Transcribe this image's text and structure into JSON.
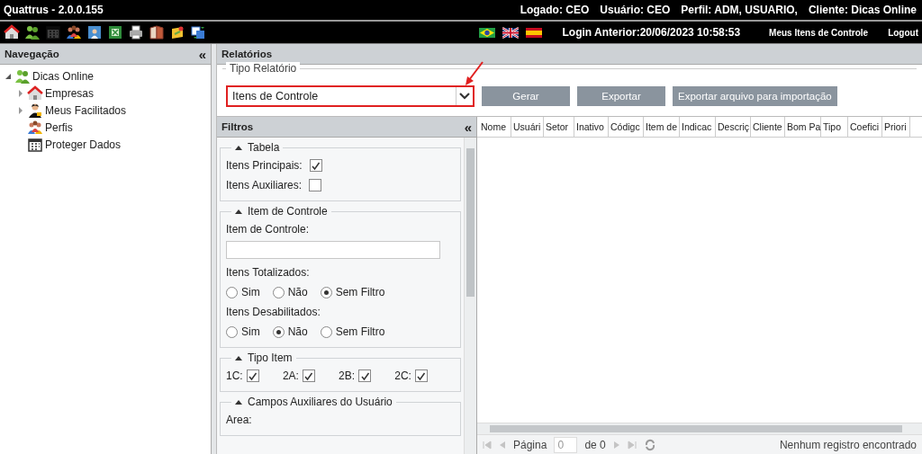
{
  "window": {
    "title": "Quattrus - 2.0.0.155"
  },
  "session": [
    {
      "label": "Logado:",
      "value": "CEO"
    },
    {
      "label": "Usuário:",
      "value": "CEO"
    },
    {
      "label": "Perfil:",
      "value": "ADM, USUARIO,"
    },
    {
      "label": "Cliente:",
      "value": "Dicas Online"
    }
  ],
  "toolbar": [
    {
      "kind": "house",
      "disabled": false
    },
    {
      "kind": "people",
      "disabled": false
    },
    {
      "kind": "calendar",
      "disabled": true
    },
    {
      "kind": "group",
      "disabled": false
    },
    {
      "kind": "portrait",
      "disabled": false
    },
    {
      "kind": "sheet",
      "disabled": false
    },
    {
      "kind": "printer",
      "disabled": false
    },
    {
      "kind": "book",
      "disabled": false
    },
    {
      "kind": "badge",
      "disabled": false
    },
    {
      "kind": "swap",
      "disabled": false
    }
  ],
  "languages": [
    {
      "kind": "brazil"
    },
    {
      "kind": "uk"
    },
    {
      "kind": "spain"
    }
  ],
  "last_login": "Login Anterior:20/06/2023 10:58:53",
  "links": [
    "Meus Itens de Controle",
    "Logout"
  ],
  "navigation": {
    "title": "Navegação",
    "collapse": "«",
    "tree": [
      {
        "label": "Dicas Online",
        "kind": "people",
        "expanded": true,
        "children": [
          {
            "label": "Empresas",
            "kind": "house",
            "expanded": false
          },
          {
            "label": "Meus Facilitados",
            "kind": "person",
            "expanded": false
          },
          {
            "label": "Perfis",
            "kind": "group"
          },
          {
            "label": "Proteger Dados",
            "kind": "calendar"
          }
        ]
      }
    ]
  },
  "reports": {
    "title": "Relatórios",
    "legend": "Tipo Relatório",
    "report_type": {
      "value": "Itens de Controle",
      "highlighted": true
    },
    "buttons": [
      "Gerar",
      "Exportar",
      "Exportar arquivo para importação"
    ]
  },
  "filters": {
    "title": "Filtros",
    "collapse": "«",
    "sections": [
      {
        "title": "Tabela",
        "items": [
          {
            "kind": "checkbox",
            "label": "Itens Principais:",
            "checked": true
          },
          {
            "kind": "checkbox",
            "label": "Itens Auxiliares:",
            "checked": false
          }
        ]
      },
      {
        "title": "Item de Controle",
        "items": [
          {
            "kind": "input",
            "label": "Item de Controle:"
          },
          {
            "kind": "radio",
            "label": "Itens Totalizados:",
            "options": [
              {
                "label": "Sim",
                "selected": false
              },
              {
                "label": "Não",
                "selected": false
              },
              {
                "label": "Sem Filtro",
                "selected": true
              }
            ]
          },
          {
            "kind": "radio",
            "label": "Itens Desabilitados:",
            "options": [
              {
                "label": "Sim",
                "selected": false
              },
              {
                "label": "Não",
                "selected": true
              },
              {
                "label": "Sem Filtro",
                "selected": false
              }
            ]
          }
        ]
      },
      {
        "title": "Tipo Item",
        "items": [
          {
            "kind": "checks",
            "options": [
              {
                "label": "1C:",
                "checked": true
              },
              {
                "label": "2A:",
                "checked": true
              },
              {
                "label": "2B:",
                "checked": true
              },
              {
                "label": "2C:",
                "checked": true
              }
            ]
          }
        ]
      },
      {
        "title": "Campos Auxiliares do Usuário",
        "items": [
          {
            "kind": "label",
            "label": "Area:"
          }
        ]
      }
    ]
  },
  "table": {
    "columns": [
      "Nome",
      "Usuári",
      "Setor",
      "Inativo",
      "Códigc",
      "Item de",
      "Indicac",
      "Descriç",
      "Cliente",
      "Bom Pa",
      "Tipo",
      "Coefici",
      "Priori"
    ]
  },
  "pager": {
    "page_label": "Página",
    "page": "0",
    "of": "de 0",
    "status": "Nenhum registro encontrado"
  }
}
